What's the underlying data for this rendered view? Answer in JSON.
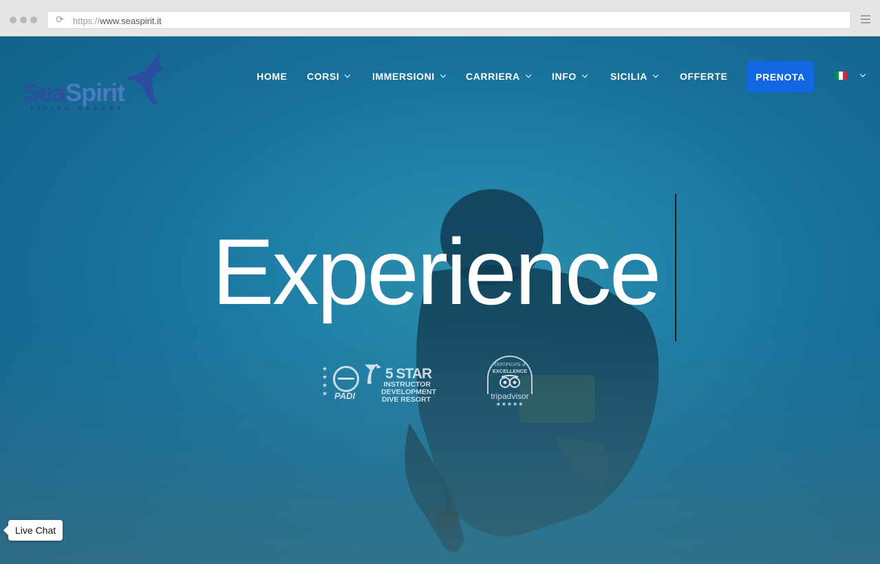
{
  "browser": {
    "url_protocol": "https://",
    "url_host": "www.seaspirit.it"
  },
  "logo": {
    "word_sea": "Sea",
    "word_spirit": "Spirit",
    "subtitle": "DIVING RESORT"
  },
  "nav": {
    "items": [
      {
        "label": "HOME",
        "dropdown": false
      },
      {
        "label": "CORSI",
        "dropdown": true
      },
      {
        "label": "IMMERSIONI",
        "dropdown": true
      },
      {
        "label": "CARRIERA",
        "dropdown": true
      },
      {
        "label": "INFO",
        "dropdown": true
      },
      {
        "label": "SICILIA",
        "dropdown": true
      },
      {
        "label": "OFFERTE",
        "dropdown": false
      }
    ],
    "cta_label": "PRENOTA",
    "language": "it-flag-icon"
  },
  "hero": {
    "headline": "Experience"
  },
  "badges": {
    "padi": {
      "brand": "PADI",
      "rating": "5 STAR",
      "line1": "INSTRUCTOR",
      "line2": "DEVELOPMENT",
      "line3": "DIVE RESORT"
    },
    "tripadvisor": {
      "certificate": "CERTIFICATE of",
      "award": "EXCELLENCE",
      "brand": "tripadvisor",
      "stars": "★★★★★"
    }
  },
  "chat": {
    "label": "Live Chat"
  },
  "colors": {
    "accent": "#1167e4",
    "logo_blue": "#2c4ea0",
    "water": "#1f7fa6"
  }
}
